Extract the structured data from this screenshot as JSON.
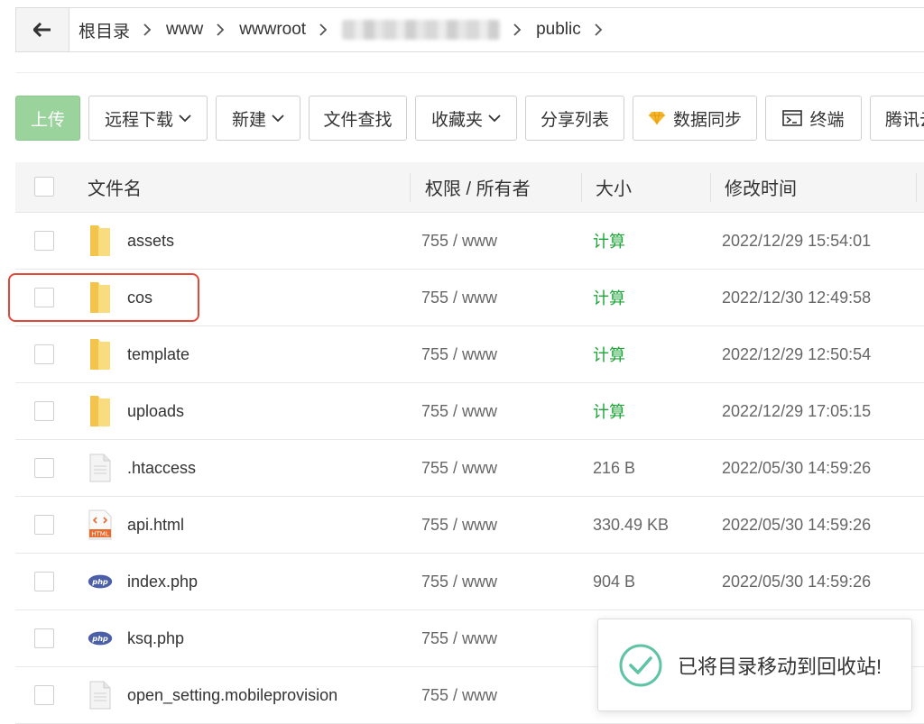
{
  "breadcrumb": {
    "items": [
      "根目录",
      "www",
      "wwwroot",
      "public"
    ]
  },
  "toolbar": {
    "upload": "上传",
    "remote_download": "远程下载",
    "new": "新建",
    "file_search": "文件查找",
    "favorites": "收藏夹",
    "share_list": "分享列表",
    "data_sync": "数据同步",
    "terminal": "终端",
    "tencent_partial": "腾讯云"
  },
  "table": {
    "headers": {
      "name": "文件名",
      "perm": "权限 / 所有者",
      "size": "大小",
      "mtime": "修改时间"
    },
    "rows": [
      {
        "name": "assets",
        "type": "folder",
        "perm": "755 / www",
        "size": "计算",
        "mtime": "2022/12/29 15:54:01"
      },
      {
        "name": "cos",
        "type": "folder",
        "perm": "755 / www",
        "size": "计算",
        "mtime": "2022/12/30 12:49:58"
      },
      {
        "name": "template",
        "type": "folder",
        "perm": "755 / www",
        "size": "计算",
        "mtime": "2022/12/29 12:50:54"
      },
      {
        "name": "uploads",
        "type": "folder",
        "perm": "755 / www",
        "size": "计算",
        "mtime": "2022/12/29 17:05:15"
      },
      {
        "name": ".htaccess",
        "type": "file",
        "perm": "755 / www",
        "size": "216 B",
        "mtime": "2022/05/30 14:59:26"
      },
      {
        "name": "api.html",
        "type": "html",
        "perm": "755 / www",
        "size": "330.49 KB",
        "mtime": "2022/05/30 14:59:26"
      },
      {
        "name": "index.php",
        "type": "php",
        "perm": "755 / www",
        "size": "904 B",
        "mtime": "2022/05/30 14:59:26"
      },
      {
        "name": "ksq.php",
        "type": "php",
        "perm": "755 / www",
        "size": "",
        "mtime": ""
      },
      {
        "name": "open_setting.mobileprovision",
        "type": "file",
        "perm": "755 / www",
        "size": "",
        "mtime": ""
      }
    ]
  },
  "toast": {
    "message": "已将目录移动到回收站!"
  },
  "icons": {
    "html_badge": "HTML",
    "php_badge": "php"
  },
  "colors": {
    "primary_green": "#9bd39d",
    "calc_green": "#20a53a",
    "highlight_red": "#e0483a",
    "folder_yellow": "#f7d26a"
  }
}
